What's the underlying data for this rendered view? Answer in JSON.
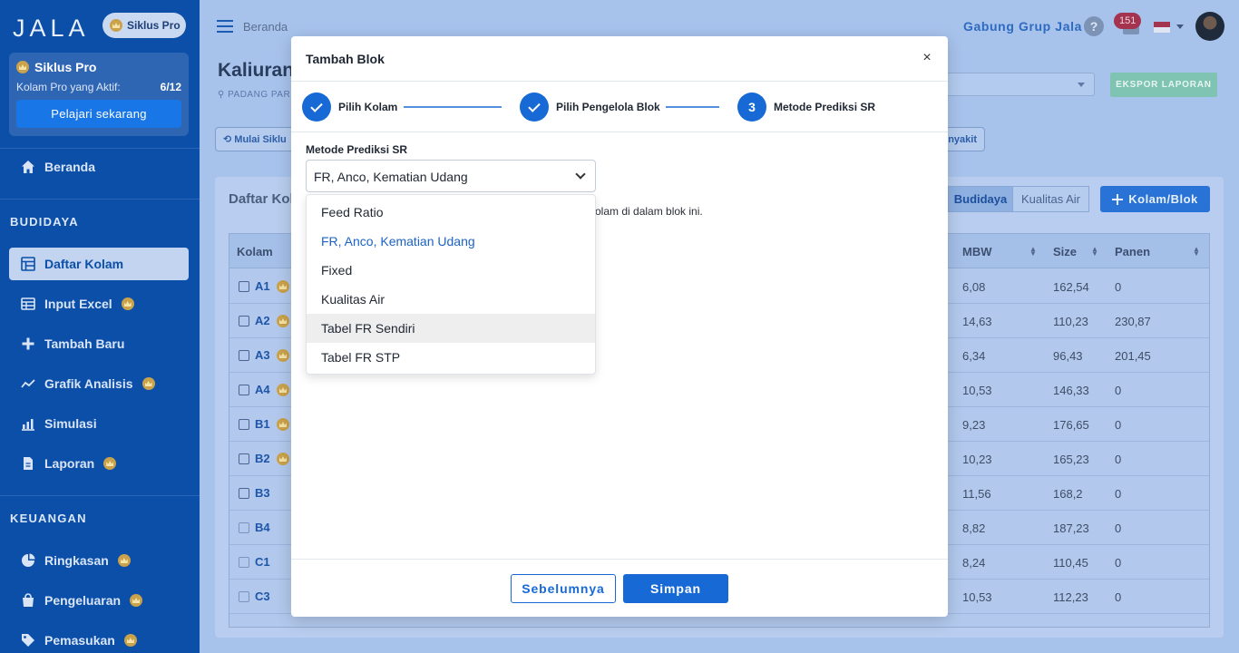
{
  "sidebar": {
    "logo": "JALA",
    "pro_pill": "Siklus Pro",
    "pro_card": {
      "title": "Siklus Pro",
      "active_label": "Kolam Pro yang Aktif:",
      "active_count": "6/12",
      "learn_button": "Pelajari sekarang"
    },
    "home": "Beranda",
    "section_budidaya": "BUDIDAYA",
    "budidaya_items": [
      {
        "label": "Daftar Kolam",
        "active": true,
        "pro": false
      },
      {
        "label": "Input Excel",
        "active": false,
        "pro": true
      },
      {
        "label": "Tambah Baru",
        "active": false,
        "pro": false
      },
      {
        "label": "Grafik Analisis",
        "active": false,
        "pro": true
      },
      {
        "label": "Simulasi",
        "active": false,
        "pro": false
      },
      {
        "label": "Laporan",
        "active": false,
        "pro": true
      }
    ],
    "section_keuangan": "KEUANGAN",
    "keuangan_items": [
      {
        "label": "Ringkasan",
        "pro": true
      },
      {
        "label": "Pengeluaran",
        "pro": true
      },
      {
        "label": "Pemasukan",
        "pro": true
      }
    ]
  },
  "topbar": {
    "breadcrumb": "Beranda",
    "join_link": "Gabung Grup Jala",
    "help": "?",
    "notification_count": "151"
  },
  "page": {
    "title": "Kaliuran",
    "subtitle": "PADANG PARI",
    "export_button": "EKSPOR LAPORAN",
    "start_cycle_chip": "Mulai Siklu",
    "disease_chip": "nyakit",
    "panel_title": "Daftar Kol",
    "tab_budidaya": "Budidaya",
    "tab_water": "Kualitas Air",
    "add_button": "Kolam/Blok",
    "columns": {
      "pond": "Kolam",
      "mbw": "MBW",
      "size": "Size",
      "harvest": "Panen"
    },
    "rows": [
      {
        "name": "A1",
        "pro": true,
        "mbw": "6,08",
        "size": "162,54",
        "harvest": "0"
      },
      {
        "name": "A2",
        "pro": true,
        "mbw": "14,63",
        "size": "110,23",
        "harvest": "230,87"
      },
      {
        "name": "A3",
        "pro": true,
        "mbw": "6,34",
        "size": "96,43",
        "harvest": "201,45"
      },
      {
        "name": "A4",
        "pro": true,
        "mbw": "10,53",
        "size": "146,33",
        "harvest": "0"
      },
      {
        "name": "B1",
        "pro": true,
        "mbw": "9,23",
        "size": "176,65",
        "harvest": "0"
      },
      {
        "name": "B2",
        "pro": true,
        "mbw": "10,23",
        "size": "165,23",
        "harvest": "0"
      },
      {
        "name": "B3",
        "pro": false,
        "mbw": "11,56",
        "size": "168,2",
        "harvest": "0"
      },
      {
        "name": "B4",
        "pro": false,
        "mbw": "8,82",
        "size": "187,23",
        "harvest": "0"
      },
      {
        "name": "C1",
        "pro": false,
        "mbw": "8,24",
        "size": "110,45",
        "harvest": "0"
      },
      {
        "name": "C3",
        "pro": false,
        "mbw": "10,53",
        "size": "112,23",
        "harvest": "0"
      }
    ]
  },
  "modal": {
    "title": "Tambah Blok",
    "close": "×",
    "steps": [
      {
        "label": "Pilih Kolam",
        "status": "done"
      },
      {
        "label": "Pilih Pengelola Blok",
        "status": "done"
      },
      {
        "label": "Metode Prediksi SR",
        "status": "current",
        "number": "3"
      }
    ],
    "field_label": "Metode Prediksi SR",
    "selected_value": "FR, Anco, Kematian Udang",
    "helper_text": "olam di dalam blok ini.",
    "options": [
      {
        "label": "Feed Ratio",
        "state": "normal"
      },
      {
        "label": "FR, Anco, Kematian Udang",
        "state": "selected"
      },
      {
        "label": "Fixed",
        "state": "normal"
      },
      {
        "label": "Kualitas Air",
        "state": "normal"
      },
      {
        "label": "Tabel FR Sendiri",
        "state": "hover"
      },
      {
        "label": "Tabel FR STP",
        "state": "normal"
      }
    ],
    "prev_button": "Sebelumnya",
    "save_button": "Simpan"
  }
}
